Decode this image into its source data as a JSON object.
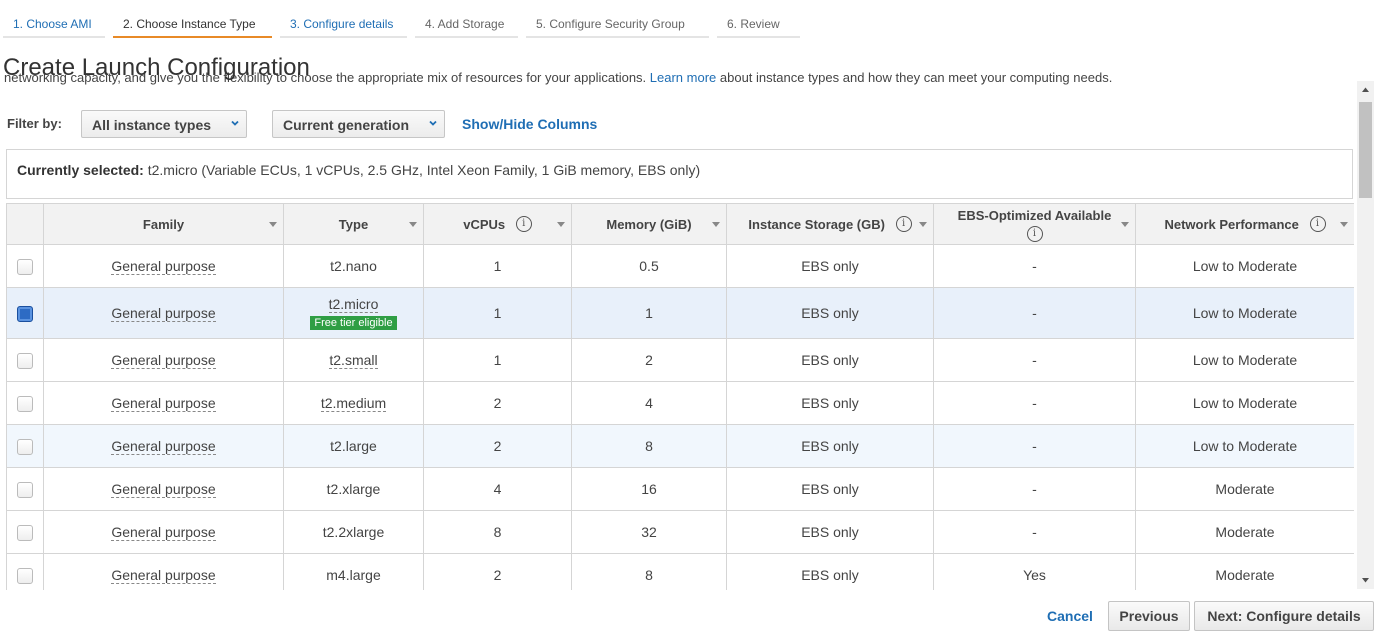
{
  "steps": [
    {
      "label": "1. Choose AMI"
    },
    {
      "label": "2. Choose Instance Type"
    },
    {
      "label": "3. Configure details"
    },
    {
      "label": "4. Add Storage"
    },
    {
      "label": "5. Configure Security Group"
    },
    {
      "label": "6. Review"
    }
  ],
  "page_title": "Create Launch Configuration",
  "intro": {
    "before": "networking capacity, and give you the flexibility to choose the appropriate mix of resources for your applications.",
    "link": "Learn more",
    "after": "about instance types and how they can meet your computing needs."
  },
  "filters": {
    "label": "Filter by:",
    "instance_types": "All instance types",
    "generation": "Current generation",
    "show_hide": "Show/Hide Columns"
  },
  "selection": {
    "label": "Currently selected:",
    "value": "t2.micro (Variable ECUs, 1 vCPUs, 2.5 GHz, Intel Xeon Family, 1 GiB memory, EBS only)"
  },
  "table": {
    "headers": {
      "family": "Family",
      "type": "Type",
      "vcpus": "vCPUs",
      "memory": "Memory (GiB)",
      "storage": "Instance Storage (GB)",
      "ebs": "EBS-Optimized Available",
      "network": "Network Performance"
    },
    "info_glyph": "i",
    "badge": "Free tier eligible",
    "rows": [
      {
        "family": "General purpose",
        "type": "t2.nano",
        "vcpus": "1",
        "memory": "0.5",
        "storage": "EBS only",
        "ebs": "-",
        "network": "Low to Moderate"
      },
      {
        "family": "General purpose",
        "type": "t2.micro",
        "vcpus": "1",
        "memory": "1",
        "storage": "EBS only",
        "ebs": "-",
        "network": "Low to Moderate"
      },
      {
        "family": "General purpose",
        "type": "t2.small",
        "vcpus": "1",
        "memory": "2",
        "storage": "EBS only",
        "ebs": "-",
        "network": "Low to Moderate"
      },
      {
        "family": "General purpose",
        "type": "t2.medium",
        "vcpus": "2",
        "memory": "4",
        "storage": "EBS only",
        "ebs": "-",
        "network": "Low to Moderate"
      },
      {
        "family": "General purpose",
        "type": "t2.large",
        "vcpus": "2",
        "memory": "8",
        "storage": "EBS only",
        "ebs": "-",
        "network": "Low to Moderate"
      },
      {
        "family": "General purpose",
        "type": "t2.xlarge",
        "vcpus": "4",
        "memory": "16",
        "storage": "EBS only",
        "ebs": "-",
        "network": "Moderate"
      },
      {
        "family": "General purpose",
        "type": "t2.2xlarge",
        "vcpus": "8",
        "memory": "32",
        "storage": "EBS only",
        "ebs": "-",
        "network": "Moderate"
      },
      {
        "family": "General purpose",
        "type": "m4.large",
        "vcpus": "2",
        "memory": "8",
        "storage": "EBS only",
        "ebs": "Yes",
        "network": "Moderate"
      }
    ]
  },
  "footer": {
    "cancel": "Cancel",
    "previous": "Previous",
    "next": "Next: Configure details"
  },
  "colors": {
    "link": "#1f6eb4",
    "active_step": "#e88a27",
    "badge": "#2f9e44",
    "selected_row": "#e8f0fa"
  }
}
